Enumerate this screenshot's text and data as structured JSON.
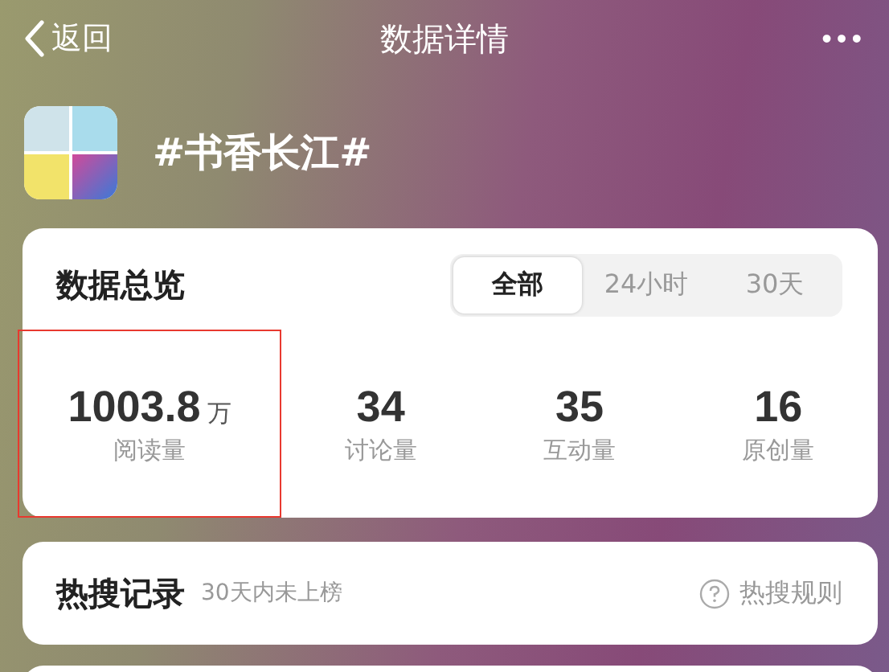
{
  "nav": {
    "back": "返回",
    "title": "数据详情",
    "more": "•••"
  },
  "topic": {
    "name": "#书香长江#"
  },
  "overview": {
    "title": "数据总览",
    "tabs": [
      {
        "label": "全部",
        "selected": true
      },
      {
        "label": "24小时",
        "selected": false
      },
      {
        "label": "30天",
        "selected": false
      }
    ],
    "stats": [
      {
        "value": "1003.8",
        "unit": "万",
        "label": "阅读量",
        "highlighted": true
      },
      {
        "value": "34",
        "label": "讨论量",
        "highlighted": false
      },
      {
        "value": "35",
        "label": "互动量",
        "highlighted": false
      },
      {
        "value": "16",
        "label": "原创量",
        "highlighted": false
      }
    ]
  },
  "hot_search": {
    "title": "热搜记录",
    "note": "30天内未上榜",
    "rules": "热搜规则"
  }
}
